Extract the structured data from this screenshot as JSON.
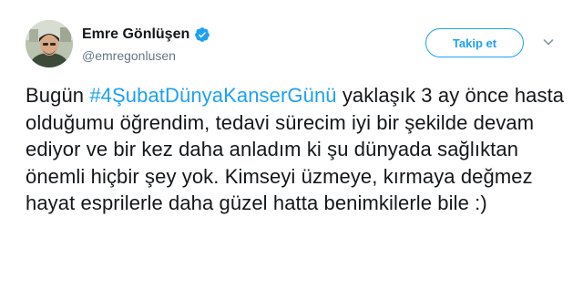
{
  "user": {
    "display_name": "Emre Gönlüşen",
    "handle": "@emregonlusen",
    "verified_icon": "verified-badge-icon",
    "avatar_icon": "profile-avatar"
  },
  "follow_button": {
    "label": "Takip et"
  },
  "menu": {
    "caret_icon": "chevron-down-icon"
  },
  "tweet": {
    "text_before": "Bugün ",
    "hashtag": "#4ŞubatDünyaKanserGünü",
    "text_after": " yaklaşık 3 ay önce hasta olduğumu öğrendim, tedavi sürecim iyi bir şekilde devam ediyor ve bir kez daha anladım ki şu dünyada sağlıktan önemli hiçbir şey yok. Kimseyi üzmeye, kırmaya değmez hayat esprilerle daha güzel hatta benimkilerle bile :)"
  },
  "colors": {
    "accent": "#1da1f2",
    "text": "#14171a",
    "secondary_text": "#657786"
  }
}
